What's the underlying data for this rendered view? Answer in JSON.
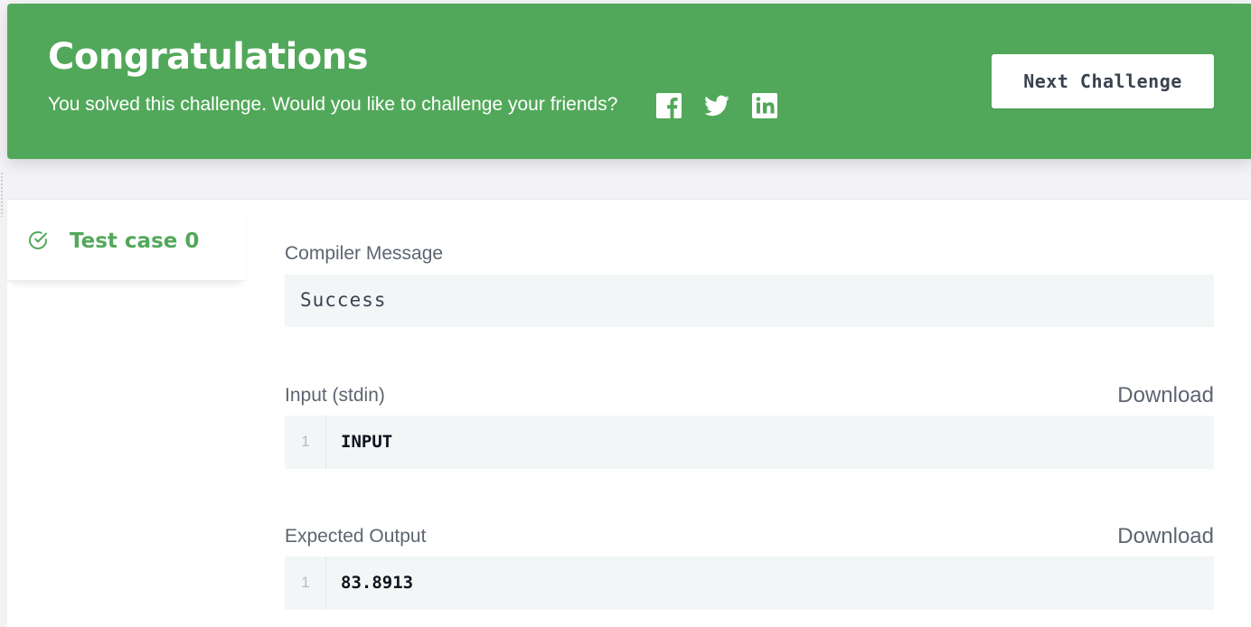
{
  "banner": {
    "title": "Congratulations",
    "subtitle": "You solved this challenge. Would you like to challenge your friends?",
    "share": [
      "facebook-icon",
      "twitter-icon",
      "linkedin-icon"
    ],
    "next_label": "Next Challenge",
    "bg_color": "#52a85a"
  },
  "tabs": [
    {
      "label": "Test case 0",
      "status": "passed",
      "icon": "check-circle-icon",
      "color": "#52a85a"
    }
  ],
  "result": {
    "compiler_label": "Compiler Message",
    "compiler_message": "Success",
    "input_label": "Input (stdin)",
    "input_download": "Download",
    "input_lines": [
      {
        "no": "1",
        "text": "INPUT"
      }
    ],
    "expected_label": "Expected Output",
    "expected_download": "Download",
    "expected_lines": [
      {
        "no": "1",
        "text": "83.8913"
      }
    ]
  }
}
